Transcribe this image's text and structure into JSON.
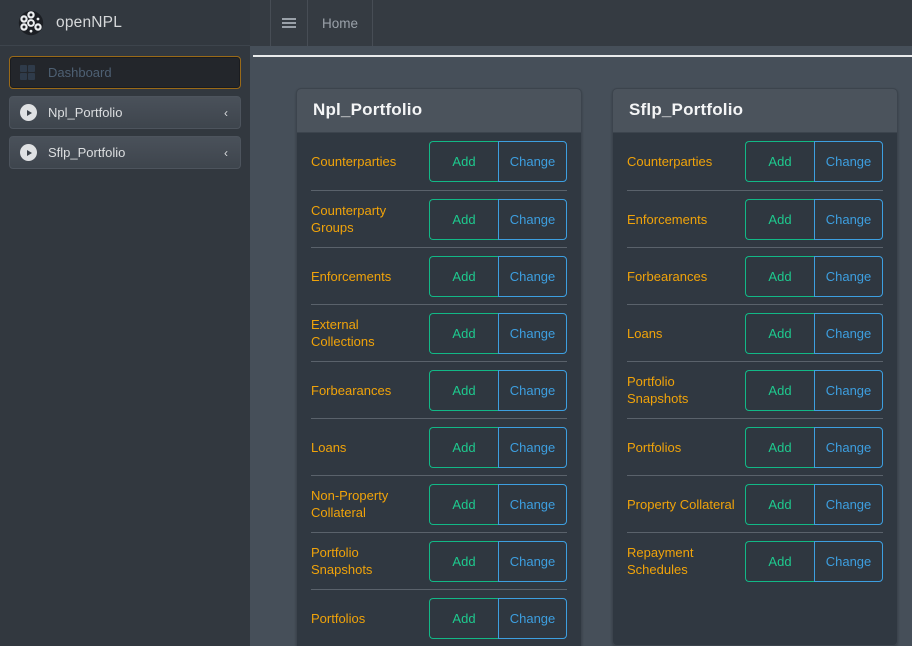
{
  "brand": {
    "name": "openNPL",
    "logo_icon": "node-cluster-logo"
  },
  "topbar": {
    "menu_icon": "hamburger-menu-icon",
    "breadcrumb": "Home"
  },
  "sidebar": {
    "items": [
      {
        "label": "Dashboard",
        "icon": "grid-icon",
        "active": true,
        "caret": ""
      },
      {
        "label": "Npl_Portfolio",
        "icon": "chevron-circle-icon",
        "active": false,
        "caret": "‹"
      },
      {
        "label": "Sflp_Portfolio",
        "icon": "chevron-circle-icon",
        "active": false,
        "caret": "‹"
      }
    ]
  },
  "buttons": {
    "add": "Add",
    "change": "Change"
  },
  "colors": {
    "accent_label": "#f0a30a",
    "add": "#12b886",
    "change": "#3d9fe0",
    "active_border": "#9a6a18",
    "panel_bg": "#303841",
    "panel_head_bg": "#4b535c",
    "sidebar_bg": "#32383f",
    "content_bg": "#464f59"
  },
  "panels": [
    {
      "title": "Npl_Portfolio",
      "clipped": true,
      "rows": [
        {
          "label": "Counterparties"
        },
        {
          "label": "Counterparty Groups"
        },
        {
          "label": "Enforcements"
        },
        {
          "label": "External Collections"
        },
        {
          "label": "Forbearances"
        },
        {
          "label": "Loans"
        },
        {
          "label": "Non-Property Collateral"
        },
        {
          "label": "Portfolio Snapshots"
        },
        {
          "label": "Portfolios"
        }
      ]
    },
    {
      "title": "Sflp_Portfolio",
      "clipped": false,
      "rows": [
        {
          "label": "Counterparties"
        },
        {
          "label": "Enforcements"
        },
        {
          "label": "Forbearances"
        },
        {
          "label": "Loans"
        },
        {
          "label": "Portfolio Snapshots"
        },
        {
          "label": "Portfolios"
        },
        {
          "label": "Property Collateral"
        },
        {
          "label": "Repayment Schedules"
        }
      ]
    }
  ]
}
